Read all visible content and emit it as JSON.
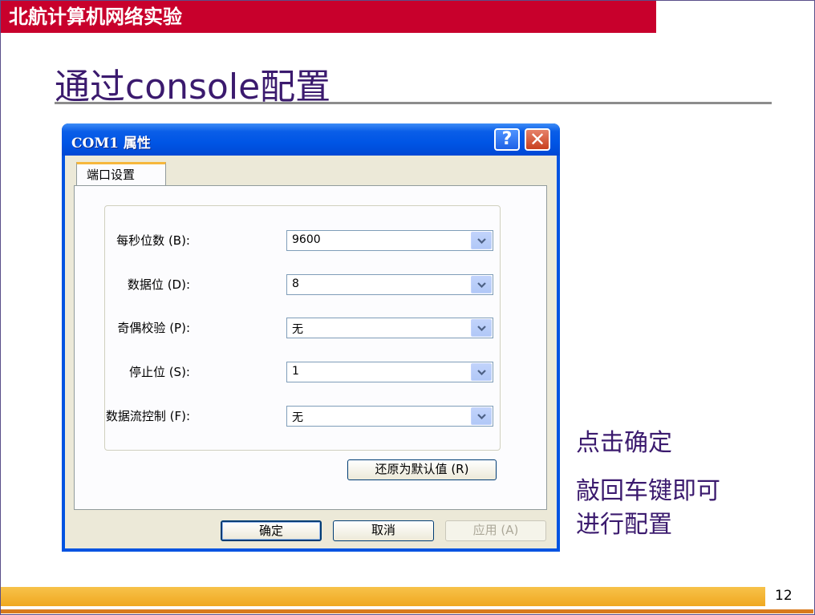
{
  "header": {
    "course": "北航计算机网络实验"
  },
  "slide": {
    "title": "通过console配置",
    "page_number": "12"
  },
  "dialog": {
    "title": "COM1 属性",
    "help_glyph": "?",
    "close_glyph": "✕",
    "tab": "端口设置",
    "fields": [
      {
        "label": "每秒位数 (B):",
        "value": "9600"
      },
      {
        "label": "数据位 (D):",
        "value": "8"
      },
      {
        "label": "奇偶校验 (P):",
        "value": "无"
      },
      {
        "label": "停止位 (S):",
        "value": "1"
      },
      {
        "label": "数据流控制 (F):",
        "value": "无"
      }
    ],
    "restore_defaults": "还原为默认值 (R)",
    "ok": "确定",
    "cancel": "取消",
    "apply": "应用 (A)"
  },
  "notes": {
    "line1": "点击确定",
    "line2": "敲回车键即可",
    "line3": "进行配置"
  },
  "colors": {
    "header_red": "#c8002c",
    "title_purple": "#3b1a6e",
    "xp_blue": "#0053e1",
    "footer_orange": "#f0a820"
  }
}
